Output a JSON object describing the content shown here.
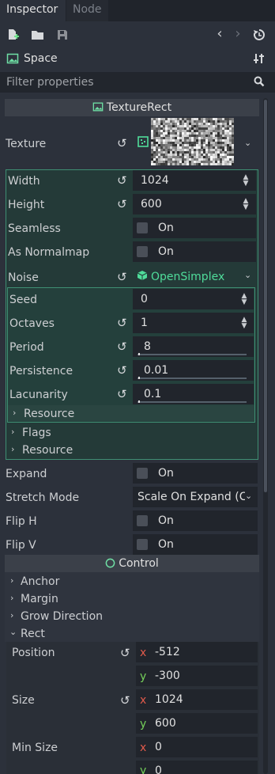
{
  "tabs": [
    {
      "label": "Inspector"
    },
    {
      "label": "Node"
    }
  ],
  "toolbar": {
    "icons": [
      "new-resource-icon",
      "open-folder-icon",
      "save-icon",
      "history-back-icon",
      "history-forward-icon",
      "object-history-icon"
    ]
  },
  "node": {
    "name": "Space"
  },
  "search": {
    "placeholder": "Filter properties"
  },
  "texture_rect": {
    "title": "TextureRect",
    "texture_label": "Texture",
    "noise_texture": {
      "width": {
        "label": "Width",
        "value": "1024"
      },
      "height": {
        "label": "Height",
        "value": "600"
      },
      "seamless": {
        "label": "Seamless",
        "value": "On",
        "checked": false
      },
      "as_normalmap": {
        "label": "As Normalmap",
        "value": "On",
        "checked": false
      },
      "noise": {
        "label": "Noise",
        "value": "OpenSimplex",
        "accent": "#4fdc9a",
        "seed": {
          "label": "Seed",
          "value": "0"
        },
        "octaves": {
          "label": "Octaves",
          "value": "1"
        },
        "period": {
          "label": "Period",
          "value": "8"
        },
        "persistence": {
          "label": "Persistence",
          "value": "0.01"
        },
        "lacunarity": {
          "label": "Lacunarity",
          "value": "0.1"
        },
        "resource_label": "Resource"
      },
      "flags_label": "Flags",
      "resource_label": "Resource"
    },
    "expand": {
      "label": "Expand",
      "value": "On",
      "checked": false
    },
    "stretch_mode": {
      "label": "Stretch Mode",
      "value": "Scale On Expand (C"
    },
    "flip_h": {
      "label": "Flip H",
      "value": "On",
      "checked": false
    },
    "flip_v": {
      "label": "Flip V",
      "value": "On",
      "checked": false
    }
  },
  "control": {
    "title": "Control",
    "groups": {
      "anchor": "Anchor",
      "margin": "Margin",
      "grow_direction": "Grow Direction",
      "rect": "Rect"
    },
    "rect": {
      "position": {
        "label": "Position",
        "x": "-512",
        "y": "-300"
      },
      "size": {
        "label": "Size",
        "x": "1024",
        "y": "600"
      },
      "min_size": {
        "label": "Min Size",
        "x": "0",
        "y": "0"
      }
    },
    "axis": {
      "x": "x",
      "y": "y"
    }
  },
  "colors": {
    "group_border": "#3f8f73",
    "accent_green": "#4fdc9a",
    "x_axis": "#e05a4b",
    "y_axis": "#75d05a"
  }
}
